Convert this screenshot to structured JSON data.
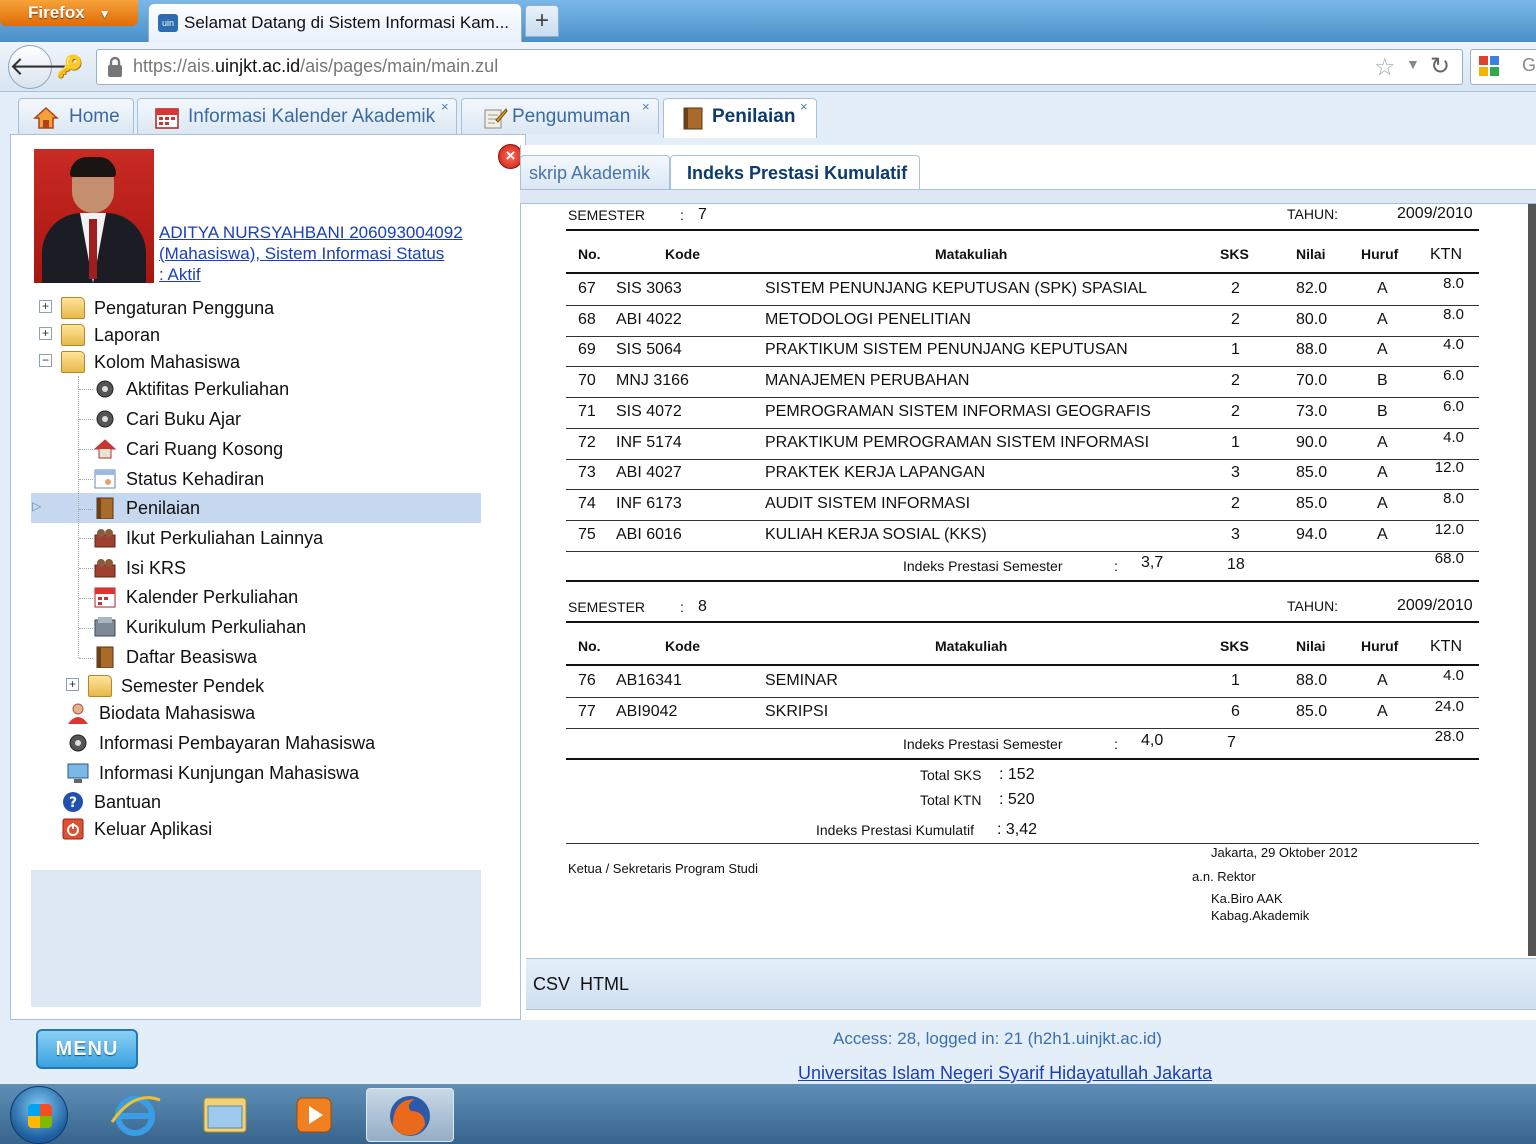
{
  "browser": {
    "app_button": "Firefox",
    "tab_title": "Selamat Datang di Sistem Informasi Kam...",
    "new_tab": "+",
    "url_prefix": "https://ais.",
    "url_domain": "uinjkt.ac.id",
    "url_path": "/ais/pages/main/main.zul",
    "search_letter": "G"
  },
  "app_tabs": [
    {
      "label": "Home",
      "closable": false
    },
    {
      "label": "Informasi Kalender Akademik",
      "closable": true
    },
    {
      "label": "Pengumuman",
      "closable": true
    },
    {
      "label": "Penilaian",
      "closable": true,
      "active": true
    }
  ],
  "user": {
    "line1": "ADITYA NURSYAHBANI 206093004092",
    "line2": "(Mahasiswa), Sistem Informasi Status",
    "line3": ": Aktif"
  },
  "menu_tree": {
    "root": [
      "Pengaturan Pengguna",
      "Laporan",
      "Kolom Mahasiswa"
    ],
    "kolom_mahasiswa": [
      "Aktifitas Perkuliahan",
      "Cari Buku Ajar",
      "Cari Ruang Kosong",
      "Status Kehadiran",
      "Penilaian",
      "Ikut Perkuliahan Lainnya",
      "Isi KRS",
      "Kalender Perkuliahan",
      "Kurikulum Perkuliahan",
      "Daftar Beasiswa",
      "Semester Pendek"
    ],
    "bottom": [
      "Biodata Mahasiswa",
      "Informasi Pembayaran Mahasiswa",
      "Informasi Kunjungan Mahasiswa",
      "Bantuan",
      "Keluar Aplikasi"
    ],
    "selected": "Penilaian"
  },
  "sub_tabs": [
    "skrip Akademik",
    "Indeks Prestasi Kumulatif"
  ],
  "table_headers": {
    "no": "No.",
    "kode": "Kode",
    "matakuliah": "Matakuliah",
    "sks": "SKS",
    "nilai": "Nilai",
    "huruf": "Huruf",
    "ktn": "KTN"
  },
  "semesters": [
    {
      "semester_label": "SEMESTER",
      "semester_sep": ":",
      "semester_value": "7",
      "tahun_label": "TAHUN:",
      "tahun_value": "2009/2010",
      "rows": [
        {
          "no": "67",
          "kode": "SIS 3063",
          "matakuliah": "SISTEM PENUNJANG KEPUTUSAN (SPK) SPASIAL",
          "sks": "2",
          "nilai": "82.0",
          "huruf": "A",
          "ktn": "8.0"
        },
        {
          "no": "68",
          "kode": "ABI 4022",
          "matakuliah": "METODOLOGI PENELITIAN",
          "sks": "2",
          "nilai": "80.0",
          "huruf": "A",
          "ktn": "8.0"
        },
        {
          "no": "69",
          "kode": "SIS 5064",
          "matakuliah": "PRAKTIKUM SISTEM PENUNJANG KEPUTUSAN",
          "sks": "1",
          "nilai": "88.0",
          "huruf": "A",
          "ktn": "4.0"
        },
        {
          "no": "70",
          "kode": "MNJ 3166",
          "matakuliah": "MANAJEMEN PERUBAHAN",
          "sks": "2",
          "nilai": "70.0",
          "huruf": "B",
          "ktn": "6.0"
        },
        {
          "no": "71",
          "kode": "SIS 4072",
          "matakuliah": "PEMROGRAMAN SISTEM INFORMASI GEOGRAFIS",
          "sks": "2",
          "nilai": "73.0",
          "huruf": "B",
          "ktn": "6.0"
        },
        {
          "no": "72",
          "kode": "INF 5174",
          "matakuliah": "PRAKTIKUM PEMROGRAMAN SISTEM INFORMASI",
          "sks": "1",
          "nilai": "90.0",
          "huruf": "A",
          "ktn": "4.0"
        },
        {
          "no": "73",
          "kode": "ABI 4027",
          "matakuliah": "PRAKTEK KERJA LAPANGAN",
          "sks": "3",
          "nilai": "85.0",
          "huruf": "A",
          "ktn": "12.0"
        },
        {
          "no": "74",
          "kode": "INF 6173",
          "matakuliah": "AUDIT SISTEM INFORMASI",
          "sks": "2",
          "nilai": "85.0",
          "huruf": "A",
          "ktn": "8.0"
        },
        {
          "no": "75",
          "kode": "ABI 6016",
          "matakuliah": "KULIAH KERJA SOSIAL (KKS)",
          "sks": "3",
          "nilai": "94.0",
          "huruf": "A",
          "ktn": "12.0"
        }
      ],
      "ips_label": "Indeks Prestasi Semester",
      "ips_sep": ":",
      "ips_value": "3,7",
      "total_sks": "18",
      "total_ktn": "68.0"
    },
    {
      "semester_label": "SEMESTER",
      "semester_sep": ":",
      "semester_value": "8",
      "tahun_label": "TAHUN:",
      "tahun_value": "2009/2010",
      "rows": [
        {
          "no": "76",
          "kode": "AB16341",
          "matakuliah": "SEMINAR",
          "sks": "1",
          "nilai": "88.0",
          "huruf": "A",
          "ktn": "4.0"
        },
        {
          "no": "77",
          "kode": "ABI9042",
          "matakuliah": "SKRIPSI",
          "sks": "6",
          "nilai": "85.0",
          "huruf": "A",
          "ktn": "24.0"
        }
      ],
      "ips_label": "Indeks Prestasi Semester",
      "ips_sep": ":",
      "ips_value": "4,0",
      "total_sks": "7",
      "total_ktn": "28.0"
    }
  ],
  "totals": {
    "total_sks_label": "Total SKS",
    "total_sks_value": ": 152",
    "total_ktn_label": "Total KTN",
    "total_ktn_value": ": 520",
    "ipk_label": "Indeks Prestasi Kumulatif",
    "ipk_value": ": 3,42"
  },
  "signature": {
    "left": "Ketua / Sekretaris Program Studi",
    "place_date": "Jakarta, 29 Oktober 2012",
    "an": "a.n. Rektor",
    "title1": "Ka.Biro AAK",
    "title2": "Kabag.Akademik"
  },
  "export": {
    "csv": "CSV",
    "html": "HTML"
  },
  "footer": {
    "menu": "MENU",
    "access": "Access: 28, logged in: 21 (h2h1.uinjkt.ac.id)",
    "university": "Universitas Islam Negeri Syarif Hidayatullah Jakarta"
  },
  "colors": {
    "accent": "#3b6fb3",
    "link": "#1a3fb8",
    "selection": "#c5d8ef",
    "chrome": "#dfeaf6"
  }
}
